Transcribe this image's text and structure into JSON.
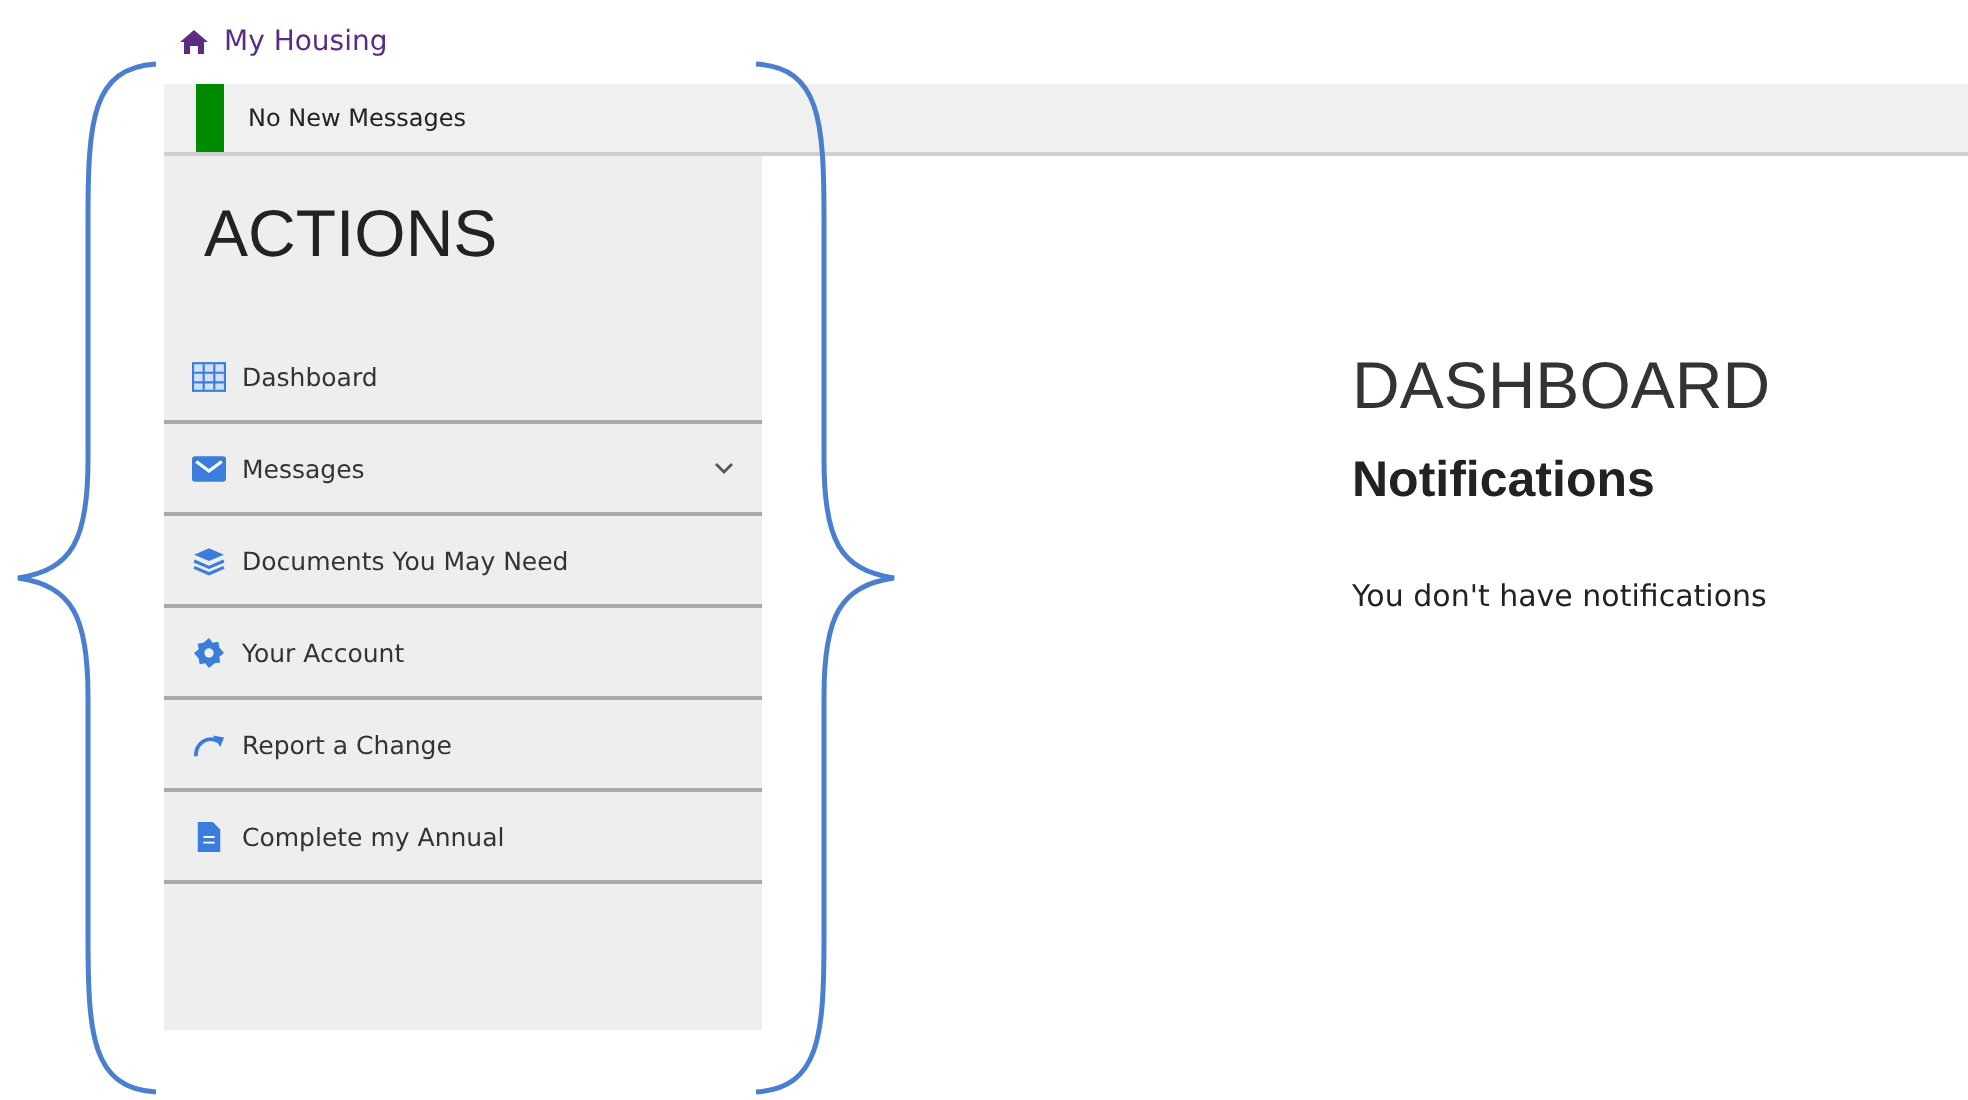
{
  "header": {
    "title": "My Housing"
  },
  "message_bar": {
    "text": "No New Messages",
    "color": "#008a00"
  },
  "sidebar": {
    "title": "ACTIONS",
    "items": [
      {
        "label": "Dashboard",
        "kind": "grid",
        "expandable": false
      },
      {
        "label": "Messages",
        "kind": "mail",
        "expandable": true
      },
      {
        "label": "Documents You May Need",
        "kind": "layers",
        "expandable": false
      },
      {
        "label": "Your Account",
        "kind": "gear",
        "expandable": false
      },
      {
        "label": "Report a Change",
        "kind": "redo",
        "expandable": false
      },
      {
        "label": "Complete my Annual",
        "kind": "document",
        "expandable": false
      }
    ]
  },
  "main": {
    "title": "DASHBOARD",
    "heading": "Notifications",
    "text": "You don't have notifications"
  }
}
